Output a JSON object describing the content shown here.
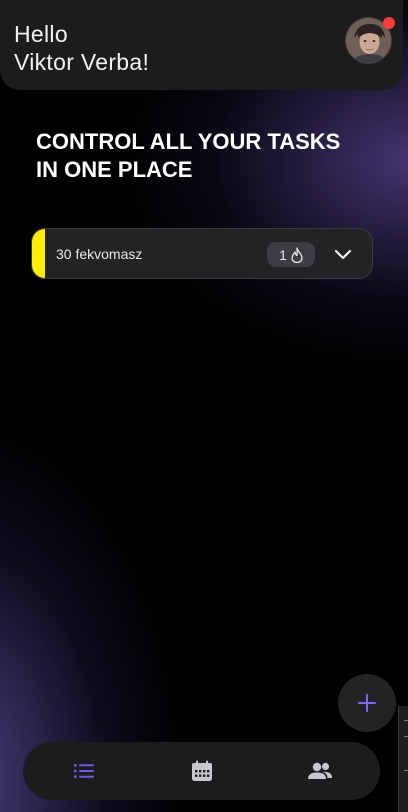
{
  "header": {
    "greeting_line1": "Hello",
    "greeting_line2": "Viktor Verba!",
    "avatar_icon": "user-avatar",
    "notification_indicator_color": "#ff3b3b"
  },
  "main": {
    "headline_line1": "CONTROL ALL YOUR TASKS",
    "headline_line2": "IN ONE PLACE",
    "tasks": [
      {
        "title": "30 fekvomasz",
        "badge_count": "1",
        "badge_icon": "flame-icon",
        "accent_color": "#ffee00",
        "expand_icon": "chevron-down-icon"
      }
    ]
  },
  "fab": {
    "icon": "plus-icon",
    "color": "#7b6cf6"
  },
  "bottom_nav": {
    "items": [
      {
        "icon": "list-icon",
        "active": true
      },
      {
        "icon": "calendar-icon",
        "active": false
      },
      {
        "icon": "people-icon",
        "active": false
      }
    ],
    "active_color": "#6a5ae0",
    "inactive_color": "#c8c8cc"
  }
}
